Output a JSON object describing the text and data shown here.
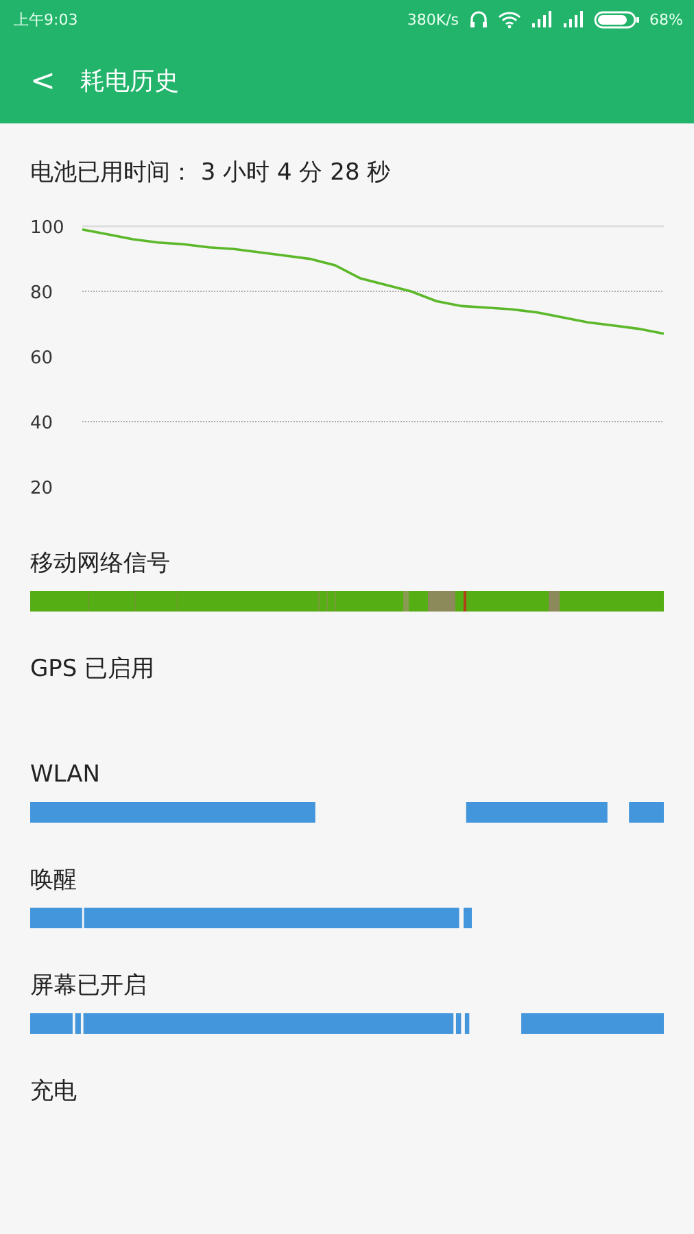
{
  "status_bar": {
    "time": "上午9:03",
    "speed": "380K/s",
    "battery": "68%"
  },
  "header": {
    "back": "<",
    "title": "耗电历史"
  },
  "usage_time": "电池已用时间： 3 小时 4 分 28 秒",
  "chart_data": {
    "type": "line",
    "ylim": [
      20,
      100
    ],
    "yticks": [
      100,
      80,
      60,
      40,
      20
    ],
    "series": [
      {
        "color": "#5cb82a",
        "values": [
          99,
          97.5,
          96,
          95,
          94.5,
          93.5,
          93,
          92,
          91,
          90,
          88,
          84,
          82,
          80,
          77,
          75.5,
          75,
          74.5,
          73.5,
          72,
          70.5,
          69.5,
          68.5,
          67
        ]
      }
    ]
  },
  "timelines": [
    {
      "label": "移动网络信号",
      "kind": "signal"
    },
    {
      "label": "GPS 已启用",
      "kind": "empty"
    },
    {
      "label": "WLAN",
      "kind": "wlan"
    },
    {
      "label": "唤醒",
      "kind": "wake"
    },
    {
      "label": "屏幕已开启",
      "kind": "screen"
    },
    {
      "label": "充电",
      "kind": "empty"
    }
  ]
}
